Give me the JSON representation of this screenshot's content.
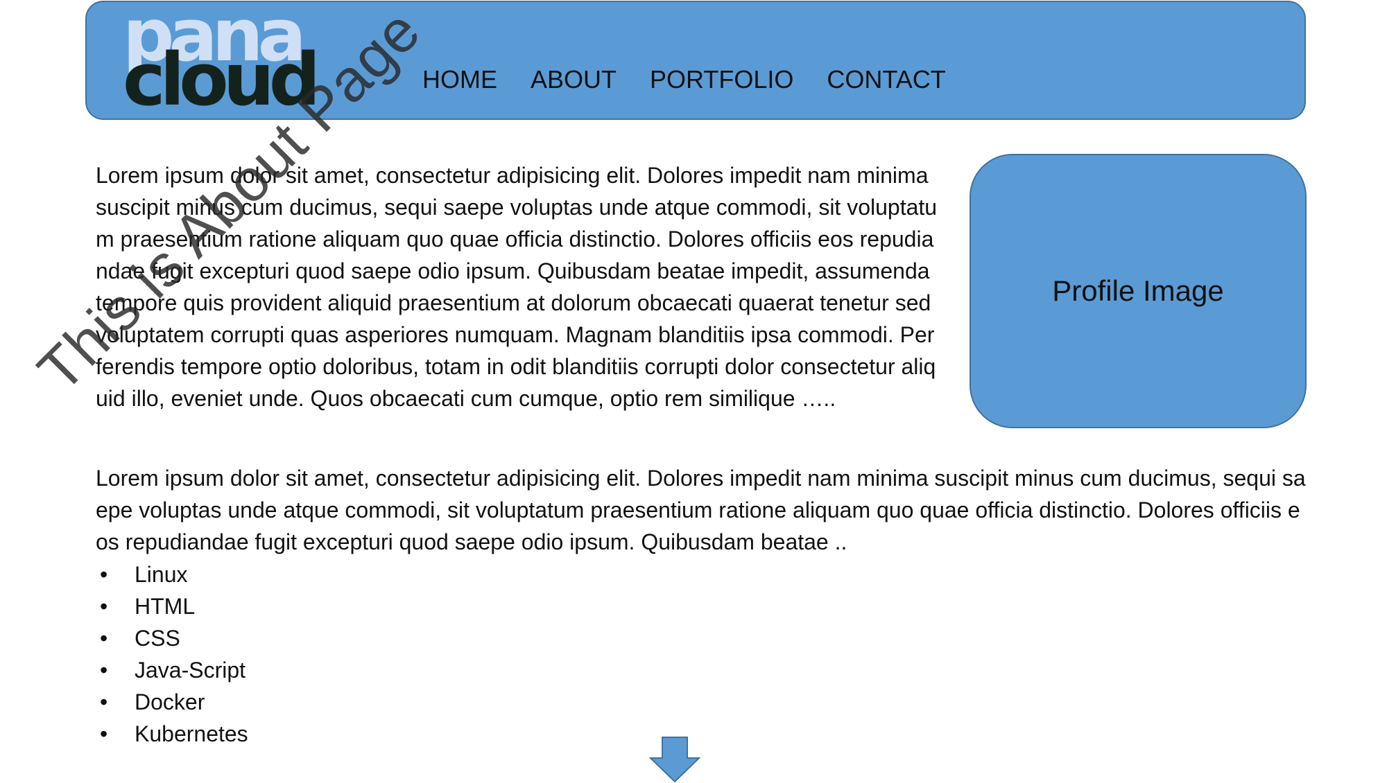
{
  "header": {
    "logo_top": "pana",
    "logo_bottom": "cloud",
    "nav": [
      "HOME",
      "ABOUT",
      "PORTFOLIO",
      "CONTACT"
    ]
  },
  "main": {
    "paragraph_1": "Lorem ipsum dolor sit amet, consectetur adipisicing elit. Dolores impedit nam minima suscipit minus cum ducimus, sequi saepe voluptas unde atque commodi, sit voluptatum praesentium ratione aliquam quo quae officia distinctio. Dolores officiis eos repudiandae fugit excepturi quod saepe odio ipsum. Quibusdam beatae impedit, assumenda tempore quis provident aliquid praesentium at dolorum obcaecati quaerat tenetur sed voluptatem corrupti quas asperiores numquam. Magnam blanditiis ipsa commodi. Perferendis tempore optio doloribus, totam in odit blanditiis corrupti dolor consectetur aliquid illo, eveniet unde. Quos obcaecati cum cumque, optio rem similique  …..",
    "profile_image_label": "Profile Image",
    "paragraph_2": "Lorem ipsum dolor sit amet, consectetur adipisicing elit. Dolores impedit nam minima suscipit minus cum ducimus, sequi saepe voluptas unde atque commodi, sit voluptatum praesentium ratione aliquam quo quae officia distinctio. Dolores officiis eos repudiandae fugit excepturi quod saepe odio ipsum. Quibusdam beatae ..",
    "skills": [
      "Linux",
      "HTML",
      "CSS",
      "Java-Script",
      "Docker",
      "Kubernetes"
    ]
  },
  "watermark": "This is About Page",
  "colors": {
    "accent": "#5b9bd5",
    "accent_border": "#41719c",
    "logo_light": "#cfe0f6",
    "logo_dark": "#14221d",
    "text": "#111111"
  },
  "icons": {
    "scroll": "down-arrow-icon"
  }
}
